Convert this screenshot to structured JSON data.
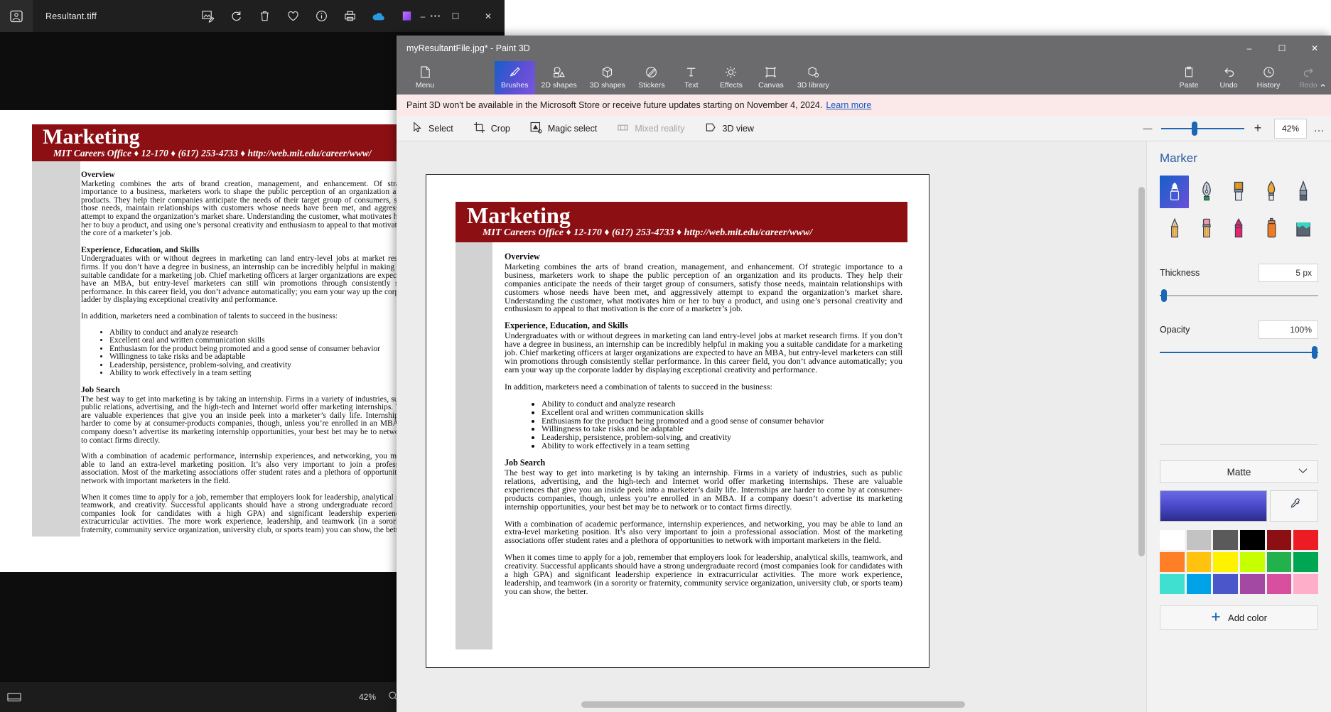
{
  "photos": {
    "title": "Resultant.tiff",
    "app_icon": "photos-icon",
    "toolbar_icons": [
      {
        "name": "edit-image-icon",
        "label": "Edit image"
      },
      {
        "name": "rotate-icon",
        "label": "Rotate"
      },
      {
        "name": "delete-icon",
        "label": "Delete"
      },
      {
        "name": "favorite-heart-icon",
        "label": "Add to favorites"
      },
      {
        "name": "info-icon",
        "label": "File info"
      },
      {
        "name": "print-icon",
        "label": "Print"
      },
      {
        "name": "onedrive-cloud-icon",
        "label": "OneDrive"
      },
      {
        "name": "designer-icon",
        "label": "Designer"
      },
      {
        "name": "more-options-icon",
        "label": "See more"
      }
    ],
    "window_controls": {
      "minimize": "–",
      "maximize": "☐",
      "close": "✕"
    },
    "status": {
      "zoom": "42%",
      "magnifier_icon": "magnifier-icon",
      "gallery_icon": "filmstrip-icon"
    }
  },
  "document": {
    "banner_title": "Marketing",
    "banner_subtitle": "MIT Careers Office ♦ 12-170 ♦ (617) 253-4733 ♦ http://web.mit.edu/career/www/",
    "sections": [
      {
        "heading": "Overview",
        "paragraphs": [
          "Marketing combines the arts of brand creation, management, and enhancement.  Of strategic importance to a business, marketers work to shape the public perception of an organization and its products.  They help their companies anticipate the needs of their target group of consumers, satisfy those needs, maintain relationships with customers whose needs have been met, and aggressively attempt to expand the organization’s market share.  Understanding the customer, what motivates him or her to buy a product, and using one’s personal creativity and enthusiasm to appeal to that motivation is the core of a marketer’s job."
        ],
        "bullets": []
      },
      {
        "heading": "Experience, Education, and Skills",
        "paragraphs": [
          "Undergraduates with or without degrees in marketing can land entry-level jobs at market research firms.  If you don’t have a degree in business, an internship can be incredibly helpful in making you a suitable candidate for a marketing job.  Chief marketing officers at larger organizations are expected to have an MBA, but entry-level marketers can still win promotions through consistently stellar performance.  In this career field, you don’t advance automatically; you earn your way up the corporate ladder by displaying exceptional creativity and performance.",
          "In addition, marketers need a combination of talents to succeed in the business:"
        ],
        "bullets": [
          "Ability to conduct and analyze research",
          "Excellent oral and written communication skills",
          "Enthusiasm for the product being promoted and a good sense of consumer behavior",
          "Willingness to take risks and be adaptable",
          "Leadership, persistence, problem-solving, and creativity",
          "Ability to work effectively in a team setting"
        ]
      },
      {
        "heading": "Job Search",
        "paragraphs": [
          "The best way to get into marketing is by taking an internship.  Firms in a variety of industries, such as public relations, advertising, and the high-tech and Internet world offer marketing internships.  These are valuable experiences that give you an inside peek into a marketer’s daily life.  Internships are harder to come by at consumer-products companies, though, unless you’re enrolled in an MBA.  If a company doesn’t advertise its marketing internship opportunities, your best bet may be to network or to contact firms directly.",
          "With a combination of academic performance, internship experiences, and networking, you may be able to land an extra-level marketing position.  It’s also very important to join a professional association.  Most of the marketing associations offer student rates and a plethora of opportunities to network with important marketers in the field.",
          "When it comes time to apply for a job, remember that employers look for leadership, analytical skills, teamwork, and creativity.  Successful applicants should have a strong undergraduate record (most companies look for candidates with a high GPA) and significant leadership experience in extracurricular activities.  The more work experience, leadership, and teamwork (in a sorority or fraternity, community service organization, university club, or sports team) you can show, the better."
        ],
        "bullets": []
      }
    ]
  },
  "paint3d": {
    "title": "myResultantFile.jpg* - Paint 3D",
    "window_controls": {
      "minimize": "–",
      "maximize": "☐",
      "close": "✕"
    },
    "menu": {
      "label": "Menu",
      "icon": "document-menu-icon"
    },
    "tabs": [
      {
        "label": "Brushes",
        "icon": "paintbrush-icon",
        "active": true
      },
      {
        "label": "2D shapes",
        "icon": "2d-shapes-icon",
        "active": false
      },
      {
        "label": "3D shapes",
        "icon": "3d-cube-icon",
        "active": false
      },
      {
        "label": "Stickers",
        "icon": "stickers-icon",
        "active": false
      },
      {
        "label": "Text",
        "icon": "text-t-icon",
        "active": false
      },
      {
        "label": "Effects",
        "icon": "effects-sun-icon",
        "active": false
      },
      {
        "label": "Canvas",
        "icon": "canvas-frame-icon",
        "active": false
      },
      {
        "label": "3D library",
        "icon": "3d-library-icon",
        "active": false
      }
    ],
    "right_actions": [
      {
        "label": "Paste",
        "icon": "clipboard-paste-icon",
        "disabled": false
      },
      {
        "label": "Undo",
        "icon": "undo-arrow-icon",
        "disabled": false
      },
      {
        "label": "History",
        "icon": "history-clock-icon",
        "disabled": false
      },
      {
        "label": "Redo",
        "icon": "redo-arrow-icon",
        "disabled": true
      }
    ],
    "collapse_caret": "⌃",
    "notice": {
      "text": "Paint 3D won't be available in the Microsoft Store or receive future updates starting on November 4, 2024.",
      "link": "Learn more"
    },
    "subbar": [
      {
        "label": "Select",
        "icon": "cursor-arrow-icon",
        "disabled": false
      },
      {
        "label": "Crop",
        "icon": "crop-icon",
        "disabled": false
      },
      {
        "label": "Magic select",
        "icon": "magic-select-icon",
        "disabled": false
      },
      {
        "label": "Mixed reality",
        "icon": "mixed-reality-icon",
        "disabled": true
      },
      {
        "label": "3D view",
        "icon": "3d-view-icon",
        "disabled": false
      }
    ],
    "zoom": {
      "minus": "—",
      "plus": "+",
      "percent": "42%",
      "more": "…",
      "slider_value": 42
    },
    "panel": {
      "title": "Marker",
      "tools": [
        {
          "name": "marker-tool",
          "selected": true
        },
        {
          "name": "calligraphy-pen-tool",
          "selected": false
        },
        {
          "name": "oil-brush-tool",
          "selected": false
        },
        {
          "name": "watercolor-tool",
          "selected": false
        },
        {
          "name": "pixel-pen-tool",
          "selected": false
        },
        {
          "name": "pencil-tool",
          "selected": false
        },
        {
          "name": "eraser-tool",
          "selected": false
        },
        {
          "name": "crayon-tool",
          "selected": false
        },
        {
          "name": "spray-can-tool",
          "selected": false
        },
        {
          "name": "fill-bucket-tool",
          "selected": false
        }
      ],
      "thickness": {
        "label": "Thickness",
        "value": "5 px",
        "percent": 4
      },
      "opacity": {
        "label": "Opacity",
        "value": "100%",
        "percent": 100
      },
      "material": {
        "value": "Matte",
        "caret_icon": "chevron-down-icon"
      },
      "current_color": "#4a4ac9",
      "eyedropper_icon": "eyedropper-icon",
      "swatches": [
        "#ffffff",
        "#c3c3c3",
        "#5a5a5a",
        "#000000",
        "#8c0f13",
        "#ed1c24",
        "#ff7f27",
        "#ffc20e",
        "#fff200",
        "#c8ff00",
        "#22b14c",
        "#00a651",
        "#3fe0d0",
        "#00a2e8",
        "#4a56c9",
        "#a349a4",
        "#d94fa0",
        "#ffaec9"
      ],
      "add_color": {
        "label": "Add color",
        "icon": "plus-icon"
      }
    }
  }
}
